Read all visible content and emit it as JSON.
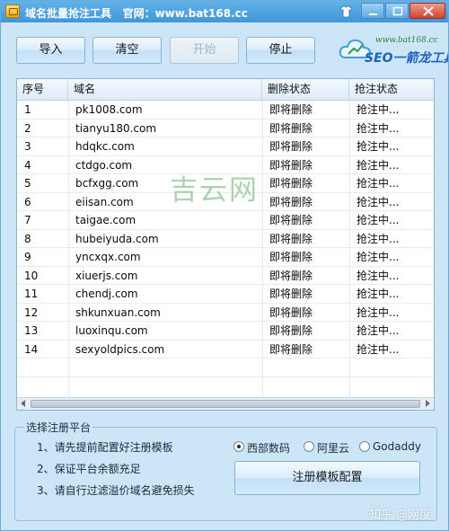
{
  "window": {
    "title": "域名批量抢注工具",
    "site_label": "官网：www.bat168.cc"
  },
  "toolbar": {
    "import_label": "导入",
    "clear_label": "清空",
    "start_label": "开始",
    "stop_label": "停止"
  },
  "logo": {
    "url": "www.bat168.cc",
    "text": "SEO一箭龙工具"
  },
  "table": {
    "columns": [
      "序号",
      "域名",
      "删除状态",
      "抢注状态"
    ],
    "rows": [
      [
        "1",
        "pk1008.com",
        "即将删除",
        "抢注中..."
      ],
      [
        "2",
        "tianyu180.com",
        "即将删除",
        "抢注中..."
      ],
      [
        "3",
        "hdqkc.com",
        "即将删除",
        "抢注中..."
      ],
      [
        "4",
        "ctdgo.com",
        "即将删除",
        "抢注中..."
      ],
      [
        "5",
        "bcfxgg.com",
        "即将删除",
        "抢注中..."
      ],
      [
        "6",
        "eiisan.com",
        "即将删除",
        "抢注中..."
      ],
      [
        "7",
        "taigae.com",
        "即将删除",
        "抢注中..."
      ],
      [
        "8",
        "hubeiyuda.com",
        "即将删除",
        "抢注中..."
      ],
      [
        "9",
        "yncxqx.com",
        "即将删除",
        "抢注中..."
      ],
      [
        "10",
        "xiuerjs.com",
        "即将删除",
        "抢注中..."
      ],
      [
        "11",
        "chendj.com",
        "即将删除",
        "抢注中..."
      ],
      [
        "12",
        "shkunxuan.com",
        "即将删除",
        "抢注中..."
      ],
      [
        "13",
        "luoxinqu.com",
        "即将删除",
        "抢注中..."
      ],
      [
        "14",
        "sexyoldpics.com",
        "即将删除",
        "抢注中..."
      ]
    ]
  },
  "watermark": "吉云网",
  "platform": {
    "legend": "选择注册平台",
    "notes": [
      "1、请先提前配置好注册模板",
      "2、保证平台余额充足",
      "3、请自行过滤溢价域名避免损失"
    ],
    "options": [
      "西部数码",
      "阿里云",
      "Godaddy"
    ],
    "selected": "西部数码",
    "config_button": "注册模板配置"
  },
  "footer_watermark": "知乎 @网度",
  "colors": {
    "titlebar": "#4aa3e2",
    "window_bg": "#cde6f7",
    "watermark": "#78b978"
  }
}
